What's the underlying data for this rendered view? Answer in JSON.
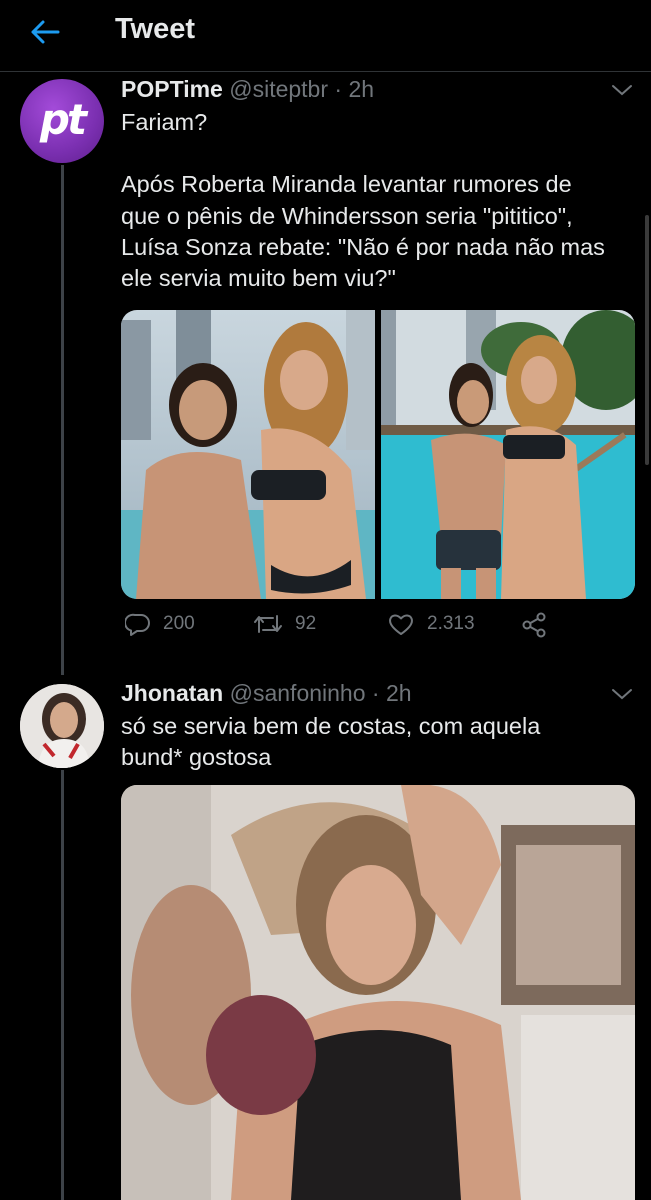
{
  "header": {
    "title": "Tweet"
  },
  "tweets": [
    {
      "display_name": "POPTime",
      "handle": "@siteptbr",
      "time": "· 2h",
      "avatar_text": "pt",
      "text_lines": [
        "Fariam?",
        "",
        "Após Roberta Miranda levantar rumores de",
        "que o pênis de Whindersson seria \"pititico\",",
        "Luísa Sonza rebate: \"Não é por nada não mas",
        "ele servia muito bem viu?\""
      ],
      "stats": {
        "replies": "200",
        "retweets": "92",
        "likes": "2.313"
      }
    },
    {
      "display_name": "Jhonatan",
      "handle": "@sanfoninho",
      "time": "· 2h",
      "text_lines": [
        "só se servia bem de costas, com aquela",
        "bund* gostosa"
      ]
    }
  ],
  "icons": {
    "back": "arrow-left-icon",
    "caret": "chevron-down-icon",
    "reply": "reply-icon",
    "retweet": "retweet-icon",
    "like": "heart-icon",
    "share": "share-icon"
  },
  "colors": {
    "accent": "#1d9bf0",
    "background": "#000000",
    "muted": "#71767b",
    "avatar_purple": "#8e3fc9"
  }
}
